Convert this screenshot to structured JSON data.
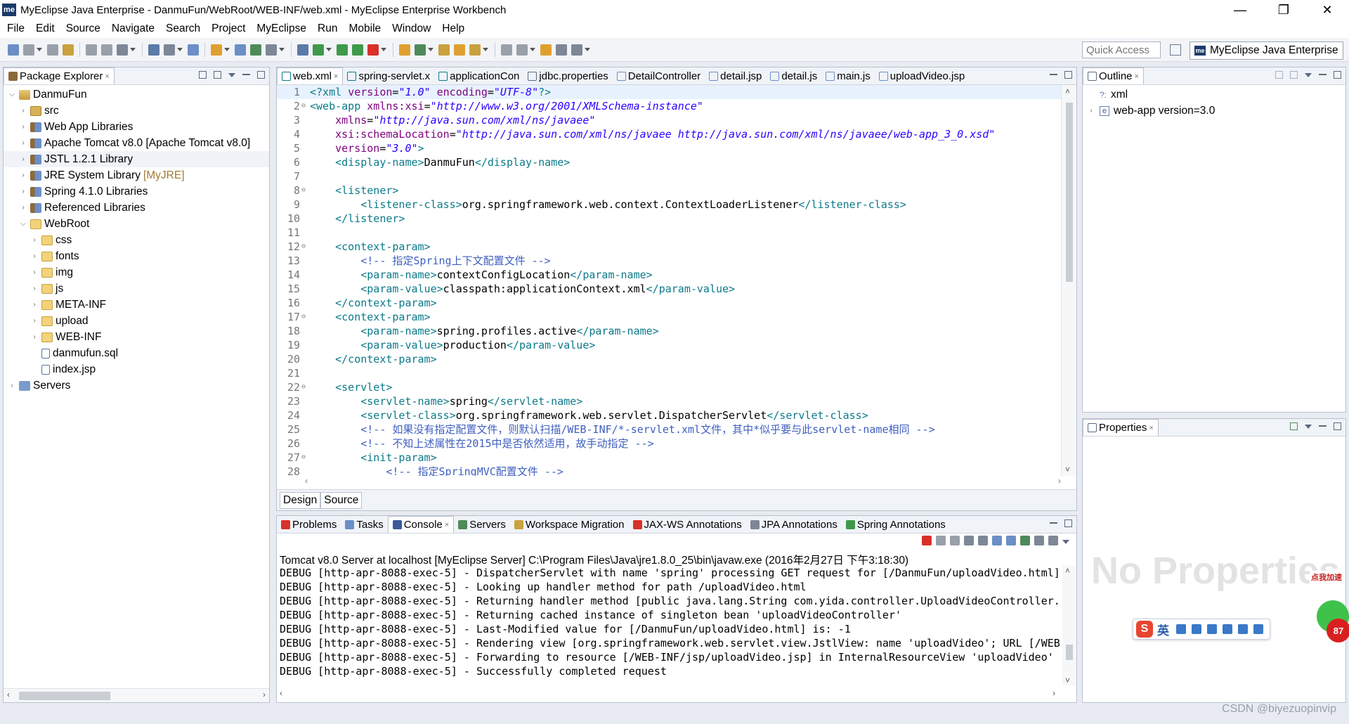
{
  "window": {
    "title": "MyEclipse Java Enterprise - DanmuFun/WebRoot/WEB-INF/web.xml - MyEclipse Enterprise Workbench",
    "logo_text": "me",
    "minimize": "—",
    "restore": "❐",
    "close": "✕"
  },
  "menu": [
    "File",
    "Edit",
    "Source",
    "Navigate",
    "Search",
    "Project",
    "MyEclipse",
    "Run",
    "Mobile",
    "Window",
    "Help"
  ],
  "toolbar": {
    "quick_access_placeholder": "Quick Access",
    "perspective_logo": "me",
    "perspective_label": "MyEclipse Java Enterprise"
  },
  "package_explorer": {
    "tab_label": "Package Explorer",
    "tree": [
      {
        "label": "DanmuFun",
        "icon": "project-icon",
        "twisty": "⌵"
      },
      {
        "label": "src",
        "icon": "source-folder-icon",
        "twisty": "›"
      },
      {
        "label": "Web App Libraries",
        "icon": "library-icon",
        "twisty": "›"
      },
      {
        "label": "Apache Tomcat v8.0 [Apache Tomcat v8.0]",
        "icon": "library-icon",
        "twisty": "›"
      },
      {
        "label": "JSTL 1.2.1 Library",
        "icon": "library-icon",
        "twisty": "›"
      },
      {
        "label": "JRE System Library",
        "deco": "[MyJRE]",
        "icon": "library-icon",
        "twisty": "›"
      },
      {
        "label": "Spring 4.1.0 Libraries",
        "icon": "library-icon",
        "twisty": "›"
      },
      {
        "label": "Referenced Libraries",
        "icon": "library-icon",
        "twisty": "›"
      },
      {
        "label": "WebRoot",
        "icon": "folder-icon",
        "twisty": "⌵"
      },
      {
        "label": "css",
        "icon": "folder-icon",
        "twisty": "›"
      },
      {
        "label": "fonts",
        "icon": "folder-icon",
        "twisty": "›"
      },
      {
        "label": "img",
        "icon": "folder-icon",
        "twisty": "›"
      },
      {
        "label": "js",
        "icon": "folder-icon",
        "twisty": "›"
      },
      {
        "label": "META-INF",
        "icon": "folder-icon",
        "twisty": "›"
      },
      {
        "label": "upload",
        "icon": "folder-icon",
        "twisty": "›"
      },
      {
        "label": "WEB-INF",
        "icon": "folder-icon",
        "twisty": "›"
      },
      {
        "label": "danmufun.sql",
        "icon": "file-icon",
        "twisty": ""
      },
      {
        "label": "index.jsp",
        "icon": "jsp-file-icon",
        "twisty": ""
      },
      {
        "label": "Servers",
        "icon": "servers-icon",
        "twisty": "›"
      }
    ]
  },
  "editor": {
    "tabs": [
      "web.xml",
      "spring-servlet.x",
      "applicationCon",
      "jdbc.properties",
      "DetailController",
      "detail.jsp",
      "detail.js",
      "main.js",
      "uploadVideo.jsp"
    ],
    "close_x": "×",
    "bottom_tabs": [
      "Design",
      "Source"
    ],
    "lines": [
      {
        "n": "1",
        "f": "",
        "segs": [
          [
            "pi",
            "<?xml "
          ],
          [
            "attr",
            "version"
          ],
          [
            "txt",
            "="
          ],
          [
            "aval",
            "\"1.0\""
          ],
          [
            "txt",
            " "
          ],
          [
            "attr",
            "encoding"
          ],
          [
            "txt",
            "="
          ],
          [
            "aval",
            "\"UTF-8\""
          ],
          [
            "pi",
            "?>"
          ]
        ]
      },
      {
        "n": "2",
        "f": "⊖",
        "segs": [
          [
            "tag",
            "<web-app "
          ],
          [
            "attr",
            "xmlns:xsi"
          ],
          [
            "txt",
            "="
          ],
          [
            "aval",
            "\"http://www.w3.org/2001/XMLSchema-instance\""
          ]
        ]
      },
      {
        "n": "3",
        "f": "",
        "segs": [
          [
            "txt",
            "    "
          ],
          [
            "attr",
            "xmlns"
          ],
          [
            "txt",
            "="
          ],
          [
            "aval",
            "\"http://java.sun.com/xml/ns/javaee\""
          ]
        ]
      },
      {
        "n": "4",
        "f": "",
        "segs": [
          [
            "txt",
            "    "
          ],
          [
            "attr",
            "xsi:schemaLocation"
          ],
          [
            "txt",
            "="
          ],
          [
            "aval",
            "\"http://java.sun.com/xml/ns/javaee http://java.sun.com/xml/ns/javaee/web-app_3_0.xsd\""
          ]
        ]
      },
      {
        "n": "5",
        "f": "",
        "segs": [
          [
            "txt",
            "    "
          ],
          [
            "attr",
            "version"
          ],
          [
            "txt",
            "="
          ],
          [
            "aval",
            "\"3.0\""
          ],
          [
            "tag",
            ">"
          ]
        ]
      },
      {
        "n": "6",
        "f": "",
        "segs": [
          [
            "txt",
            "    "
          ],
          [
            "tag",
            "<display-name>"
          ],
          [
            "txt",
            "DanmuFun"
          ],
          [
            "tag",
            "</display-name>"
          ]
        ]
      },
      {
        "n": "7",
        "f": "",
        "segs": []
      },
      {
        "n": "8",
        "f": "⊖",
        "segs": [
          [
            "txt",
            "    "
          ],
          [
            "tag",
            "<listener>"
          ]
        ]
      },
      {
        "n": "9",
        "f": "",
        "segs": [
          [
            "txt",
            "        "
          ],
          [
            "tag",
            "<listener-class>"
          ],
          [
            "txt",
            "org.springframework.web.context.ContextLoaderListener"
          ],
          [
            "tag",
            "</listener-class>"
          ]
        ]
      },
      {
        "n": "10",
        "f": "",
        "segs": [
          [
            "txt",
            "    "
          ],
          [
            "tag",
            "</listener>"
          ]
        ]
      },
      {
        "n": "11",
        "f": "",
        "segs": []
      },
      {
        "n": "12",
        "f": "⊖",
        "segs": [
          [
            "txt",
            "    "
          ],
          [
            "tag",
            "<context-param>"
          ]
        ]
      },
      {
        "n": "13",
        "f": "",
        "segs": [
          [
            "txt",
            "        "
          ],
          [
            "comment",
            "<!-- 指定Spring上下文配置文件 -->"
          ]
        ]
      },
      {
        "n": "14",
        "f": "",
        "segs": [
          [
            "txt",
            "        "
          ],
          [
            "tag",
            "<param-name>"
          ],
          [
            "txt",
            "contextConfigLocation"
          ],
          [
            "tag",
            "</param-name>"
          ]
        ]
      },
      {
        "n": "15",
        "f": "",
        "segs": [
          [
            "txt",
            "        "
          ],
          [
            "tag",
            "<param-value>"
          ],
          [
            "txt",
            "classpath:applicationContext.xml"
          ],
          [
            "tag",
            "</param-value>"
          ]
        ]
      },
      {
        "n": "16",
        "f": "",
        "segs": [
          [
            "txt",
            "    "
          ],
          [
            "tag",
            "</context-param>"
          ]
        ]
      },
      {
        "n": "17",
        "f": "⊖",
        "segs": [
          [
            "txt",
            "    "
          ],
          [
            "tag",
            "<context-param>"
          ]
        ]
      },
      {
        "n": "18",
        "f": "",
        "segs": [
          [
            "txt",
            "        "
          ],
          [
            "tag",
            "<param-name>"
          ],
          [
            "txt",
            "spring.profiles.active"
          ],
          [
            "tag",
            "</param-name>"
          ]
        ]
      },
      {
        "n": "19",
        "f": "",
        "segs": [
          [
            "txt",
            "        "
          ],
          [
            "tag",
            "<param-value>"
          ],
          [
            "txt",
            "production"
          ],
          [
            "tag",
            "</param-value>"
          ]
        ]
      },
      {
        "n": "20",
        "f": "",
        "segs": [
          [
            "txt",
            "    "
          ],
          [
            "tag",
            "</context-param>"
          ]
        ]
      },
      {
        "n": "21",
        "f": "",
        "segs": []
      },
      {
        "n": "22",
        "f": "⊖",
        "segs": [
          [
            "txt",
            "    "
          ],
          [
            "tag",
            "<servlet>"
          ]
        ]
      },
      {
        "n": "23",
        "f": "",
        "segs": [
          [
            "txt",
            "        "
          ],
          [
            "tag",
            "<servlet-name>"
          ],
          [
            "txt",
            "spring"
          ],
          [
            "tag",
            "</servlet-name>"
          ]
        ]
      },
      {
        "n": "24",
        "f": "",
        "segs": [
          [
            "txt",
            "        "
          ],
          [
            "tag",
            "<servlet-class>"
          ],
          [
            "txt",
            "org.springframework.web.servlet.DispatcherServlet"
          ],
          [
            "tag",
            "</servlet-class>"
          ]
        ]
      },
      {
        "n": "25",
        "f": "",
        "segs": [
          [
            "txt",
            "        "
          ],
          [
            "comment",
            "<!-- 如果没有指定配置文件，则默认扫描/WEB-INF/*-servlet.xml文件，其中*似乎要与此servlet-name相同 -->"
          ]
        ]
      },
      {
        "n": "26",
        "f": "",
        "segs": [
          [
            "txt",
            "        "
          ],
          [
            "comment",
            "<!-- 不知上述属性在2015中是否依然适用，故手动指定 -->"
          ]
        ]
      },
      {
        "n": "27",
        "f": "⊖",
        "segs": [
          [
            "txt",
            "        "
          ],
          [
            "tag",
            "<init-param>"
          ]
        ]
      },
      {
        "n": "28",
        "f": "",
        "segs": [
          [
            "txt",
            "            "
          ],
          [
            "comment",
            "<!-- 指定SpringMVC配置文件 -->"
          ]
        ]
      }
    ]
  },
  "console": {
    "tabs": [
      "Problems",
      "Tasks",
      "Console",
      "Servers",
      "Workspace Migration",
      "JAX-WS Annotations",
      "JPA Annotations",
      "Spring Annotations"
    ],
    "active_tab": "Console",
    "header": "Tomcat v8.0 Server at localhost [MyEclipse Server] C:\\Program Files\\Java\\jre1.8.0_25\\bin\\javaw.exe (2016年2月27日 下午3:18:30)",
    "lines": [
      "DEBUG [http-apr-8088-exec-5] - DispatcherServlet with name 'spring' processing GET request for [/DanmuFun/uploadVideo.html]",
      "DEBUG [http-apr-8088-exec-5] - Looking up handler method for path /uploadVideo.html",
      "DEBUG [http-apr-8088-exec-5] - Returning handler method [public java.lang.String com.yida.controller.UploadVideoController.u",
      "DEBUG [http-apr-8088-exec-5] - Returning cached instance of singleton bean 'uploadVideoController'",
      "DEBUG [http-apr-8088-exec-5] - Last-Modified value for [/DanmuFun/uploadVideo.html] is: -1",
      "DEBUG [http-apr-8088-exec-5] - Rendering view [org.springframework.web.servlet.view.JstlView: name 'uploadVideo'; URL [/WEB-",
      "DEBUG [http-apr-8088-exec-5] - Forwarding to resource [/WEB-INF/jsp/uploadVideo.jsp] in InternalResourceView 'uploadVideo'",
      "DEBUG [http-apr-8088-exec-5] - Successfully completed request"
    ]
  },
  "outline": {
    "tab_label": "Outline",
    "items": [
      {
        "label": "xml",
        "prefix": "?:",
        "twisty": ""
      },
      {
        "label": "web-app version=3.0",
        "prefix": "e",
        "twisty": "›"
      }
    ]
  },
  "properties": {
    "tab_label": "Properties",
    "empty_text": "No Properties"
  },
  "ime": {
    "logo": "S",
    "mode": "英",
    "accelerate_label": "点我加速",
    "accelerate_count": "87"
  },
  "watermark": "CSDN @biyezuopinvip",
  "colors": {
    "xml_tag": "#0b7a8a",
    "xml_attr": "#7f007f",
    "xml_value": "#2a00ff",
    "xml_comment": "#3f5fbf"
  }
}
